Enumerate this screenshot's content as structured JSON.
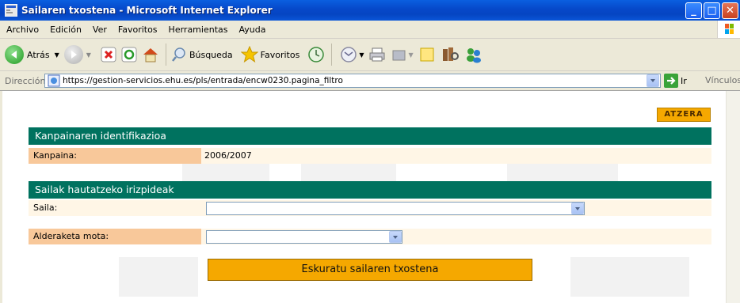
{
  "window": {
    "title": "Sailaren txostena - Microsoft Internet Explorer"
  },
  "menu": [
    "Archivo",
    "Edición",
    "Ver",
    "Favoritos",
    "Herramientas",
    "Ayuda"
  ],
  "toolbar": {
    "back_label": "Atrás",
    "search_label": "Búsqueda",
    "favorites_label": "Favoritos"
  },
  "address": {
    "label": "Dirección",
    "url": "https://gestion-servicios.ehu.es/pls/entrada/encw0230.pagina_filtro",
    "go_label": "Ir",
    "links_label": "Vínculos"
  },
  "page": {
    "back_button": "ATZERA",
    "section1": {
      "title": "Kanpainaren identifikazioa",
      "campaign_label": "Kanpaina:",
      "campaign_value": "2006/2007"
    },
    "section2": {
      "title": "Sailak hautatzeko irizpideak",
      "department_label": "Saila:",
      "department_value": "",
      "comparison_label": "Alderaketa mota:",
      "comparison_value": ""
    },
    "submit_button": "Eskuratu sailaren txostena"
  },
  "colors": {
    "section_header": "#00725f",
    "label_bg": "#f8c89a",
    "row_bg": "#fff6e6",
    "button": "#f5a800"
  }
}
